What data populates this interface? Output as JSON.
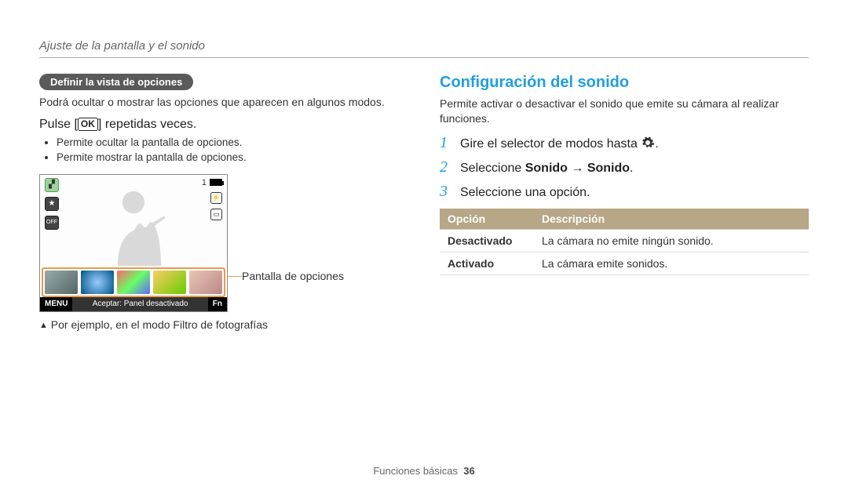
{
  "header": "Ajuste de la pantalla y el sonido",
  "left": {
    "pill": "Definir la vista de opciones",
    "intro": "Podrá ocultar o mostrar las opciones que aparecen en algunos modos.",
    "instruction_pre": "Pulse [",
    "ok": "OK",
    "instruction_post": "] repetidas veces.",
    "bullets": [
      "Permite ocultar la pantalla de opciones.",
      "Permite mostrar la pantalla de opciones."
    ],
    "screenshot": {
      "count": "1",
      "bar_left": "MENU",
      "bar_mid": "Aceptar: Panel desactivado",
      "bar_right": "Fn"
    },
    "callout": "Pantalla de opciones",
    "caption": "Por ejemplo, en el modo Filtro de fotografías"
  },
  "right": {
    "title": "Configuración del sonido",
    "intro": "Permite activar o desactivar el sonido que emite su cámara al realizar funciones.",
    "steps": [
      {
        "num": "1",
        "text_pre": "Gire el selector de modos hasta ",
        "text_post": "."
      },
      {
        "num": "2",
        "text_pre": "Seleccione ",
        "bold1": "Sonido",
        "arrow": " → ",
        "bold2": "Sonido",
        "text_post": "."
      },
      {
        "num": "3",
        "text_pre": "Seleccione una opción."
      }
    ],
    "table": {
      "headers": [
        "Opción",
        "Descripción"
      ],
      "rows": [
        [
          "Desactivado",
          "La cámara no emite ningún sonido."
        ],
        [
          "Activado",
          "La cámara emite sonidos."
        ]
      ]
    }
  },
  "footer": {
    "section": "Funciones básicas",
    "page": "36"
  }
}
